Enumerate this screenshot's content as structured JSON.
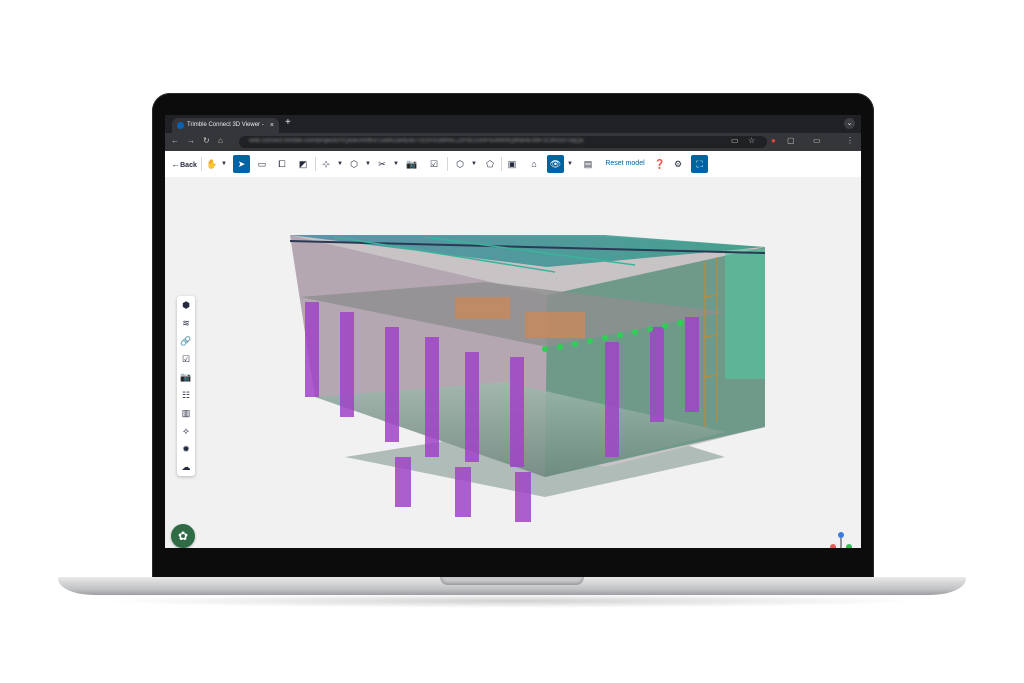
{
  "browser": {
    "tab_title": "Trimble Connect 3D Viewer -",
    "tab_close": "×",
    "new_tab": "+",
    "url_text": "web.connect.trimble.com/projects/VQwaUnHtKeTuaWZamEbxTnz3VsOdfReLZzPdCcsHPvDkM0tQbNe4EWiF2ClmScf7xqQa"
  },
  "toolbar": {
    "back_label": "Back",
    "reset_label": "Reset model"
  },
  "colors": {
    "brand_blue": "#0063a3",
    "toolbar_text": "#252a3f",
    "fab_green": "#2f6b45"
  }
}
